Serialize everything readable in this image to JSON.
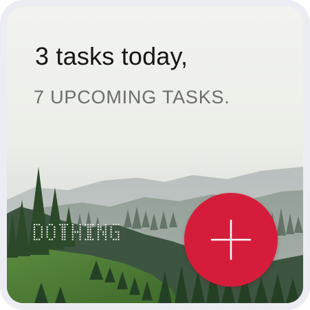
{
  "widget": {
    "headline": "3 tasks today,",
    "subline": "7 UPCOMING TASKS.",
    "brand": "DOTHING",
    "add_button": {
      "icon": "plus-icon",
      "color": "#d51d3b"
    }
  }
}
